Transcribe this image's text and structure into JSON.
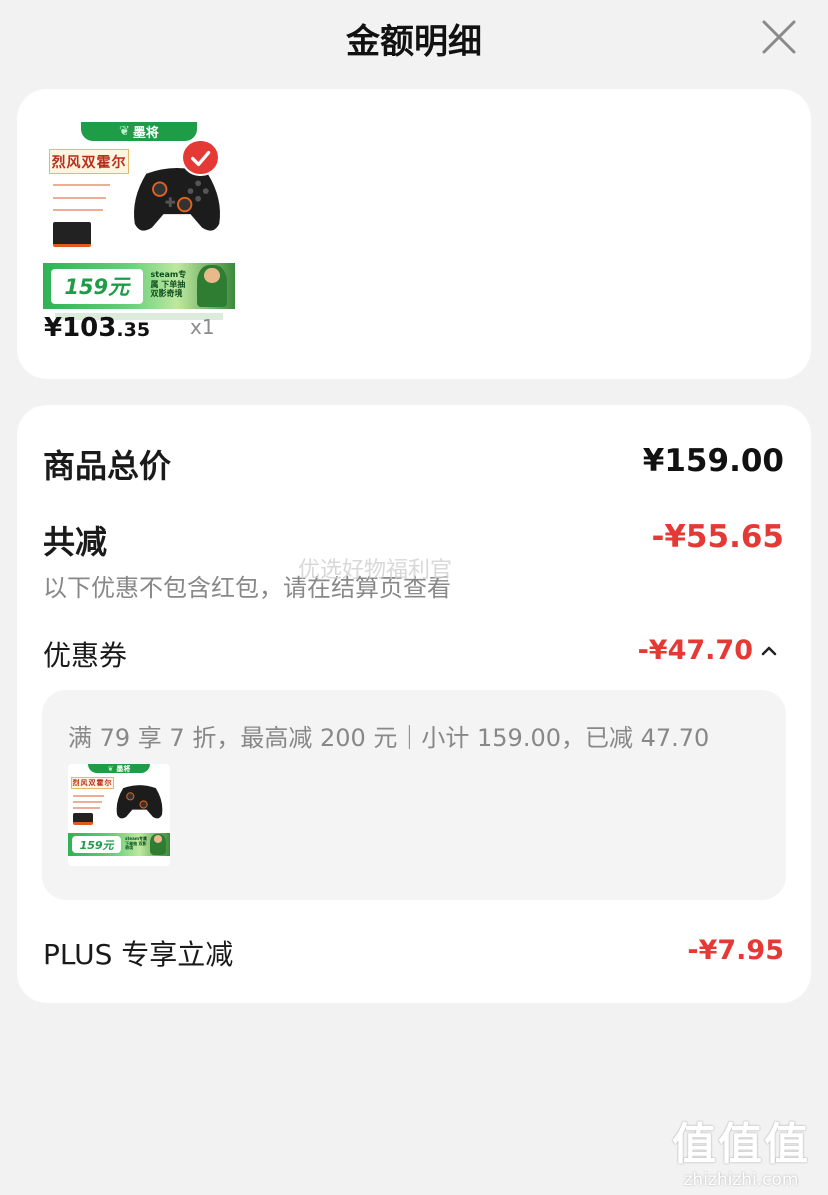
{
  "header": {
    "title": "金额明细",
    "close_icon": "close-icon"
  },
  "product": {
    "thumbnail": {
      "brand": "墨将",
      "promo_title": "烈风双霍尔",
      "price_tag": "159元",
      "side_text": "steam专属 下单抽 双影奇境"
    },
    "selected": true,
    "price_main": "¥103",
    "price_cents": ".35",
    "quantity": "x1"
  },
  "summary": {
    "total_label": "商品总价",
    "total_value": "¥159.00",
    "discount_label": "共减",
    "discount_value": "-¥55.65",
    "hint": "以下优惠不包含红包，请在结算页查看",
    "coupon_label": "优惠券",
    "coupon_value": "-¥47.70",
    "coupon_expanded": true,
    "coupon_detail": "满 79 享 7 折，最高减 200 元｜小计 159.00，已减 47.70",
    "plus_label": "PLUS 专享立减",
    "plus_value": "-¥7.95"
  },
  "watermarks": {
    "center": "优选好物福利官",
    "logo_glyphs": "值值值",
    "logo_url": "zhizhizhi.com"
  },
  "colors": {
    "accent_red": "#e53935",
    "brand_green": "#1f9c48",
    "background": "#f2f2f2",
    "card": "#ffffff"
  }
}
